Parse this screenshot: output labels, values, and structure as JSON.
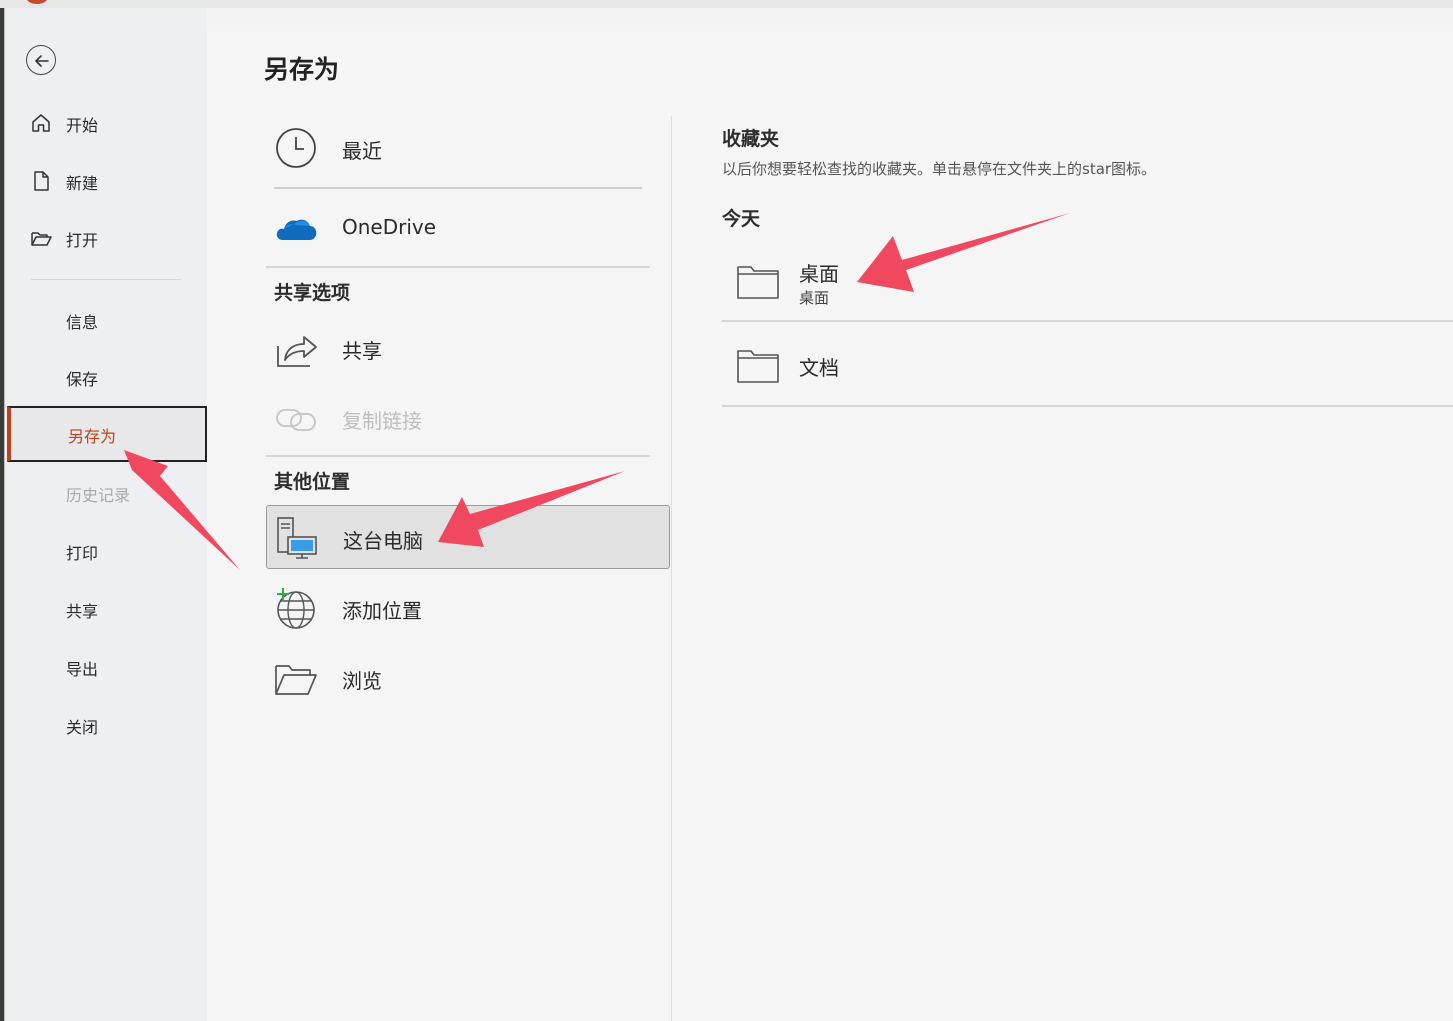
{
  "page_title": "另存为",
  "sidebar": {
    "items": [
      {
        "label": "开始",
        "icon": "home-icon"
      },
      {
        "label": "新建",
        "icon": "new-document-icon"
      },
      {
        "label": "打开",
        "icon": "open-folder-icon"
      },
      {
        "label": "信息"
      },
      {
        "label": "保存"
      },
      {
        "label": "另存为",
        "active": true
      },
      {
        "label": "历史记录",
        "disabled": true
      },
      {
        "label": "打印"
      },
      {
        "label": "共享"
      },
      {
        "label": "导出"
      },
      {
        "label": "关闭"
      }
    ]
  },
  "locations": {
    "recent": "最近",
    "onedrive": "OneDrive",
    "share_section": "共享选项",
    "share": "共享",
    "copy_link": "复制链接",
    "other_section": "其他位置",
    "this_pc": "这台电脑",
    "add_place": "添加位置",
    "browse": "浏览"
  },
  "favorites": {
    "title": "收藏夹",
    "description": "以后你想要轻松查找的收藏夹。单击悬停在文件夹上的star图标。",
    "today": "今天",
    "folders": [
      {
        "name": "桌面",
        "path": "桌面"
      },
      {
        "name": "文档"
      }
    ]
  },
  "colors": {
    "accent": "#c43e1c",
    "annotation_arrow": "#f0485e",
    "onedrive": "#0f6cbd"
  }
}
